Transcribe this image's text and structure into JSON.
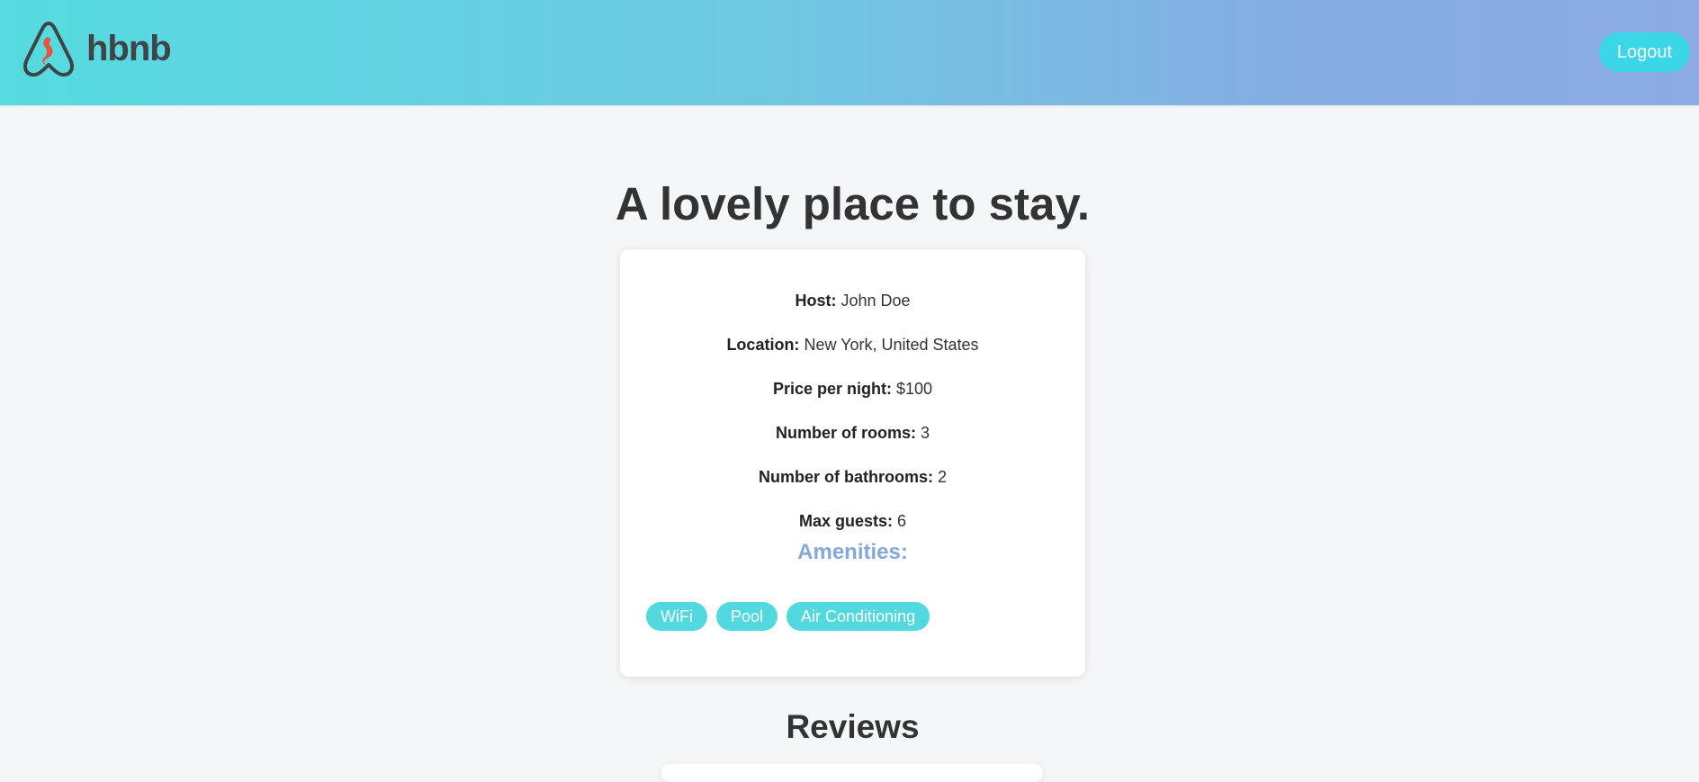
{
  "header": {
    "logo_text": "hbnb",
    "logo_icon": "airbnb-seahorse-icon",
    "logout_label": "Logout",
    "gradient": [
      "#55dbe0",
      "#8dabe5"
    ]
  },
  "place": {
    "title": "A lovely place to stay.",
    "details": [
      {
        "label": "Host:",
        "value": "John Doe"
      },
      {
        "label": "Location:",
        "value": "New York, United States"
      },
      {
        "label": "Price per night:",
        "value": "$100"
      },
      {
        "label": "Number of rooms:",
        "value": "3"
      },
      {
        "label": "Number of bathrooms:",
        "value": "2"
      },
      {
        "label": "Max guests:",
        "value": "6"
      }
    ],
    "amenities_title": "Amenities:",
    "amenities": [
      "WiFi",
      "Pool",
      "Air Conditioning"
    ]
  },
  "reviews": {
    "title": "Reviews"
  },
  "colors": {
    "accent": "#3bd6e8",
    "chip": "#52d8df",
    "amenities_heading": "#86a8dd",
    "background": "#f5f6f8"
  }
}
